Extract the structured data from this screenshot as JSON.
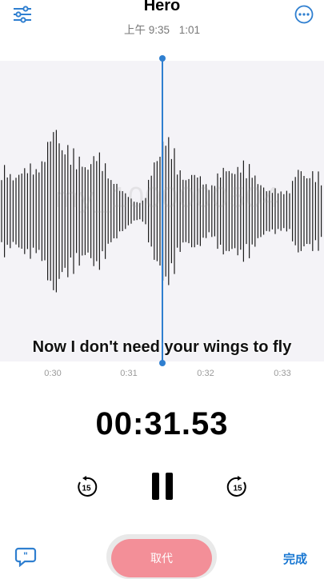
{
  "header": {
    "title": "Hero",
    "time": "上午 9:35",
    "duration": "1:01"
  },
  "waveform": {
    "watermark": "my_1000000504"
  },
  "timeline": {
    "ticks": [
      "0:30",
      "0:31",
      "0:32",
      "0:33"
    ]
  },
  "lyric": "Now I don't need your wings to fly",
  "player": {
    "current_time": "00:31.53",
    "skip_back_label": "15",
    "skip_forward_label": "15"
  },
  "footer": {
    "replace_label": "取代",
    "done_label": "完成"
  },
  "colors": {
    "accent": "#2f7fd0",
    "replace": "#f38f98",
    "done": "#1a78d2"
  }
}
